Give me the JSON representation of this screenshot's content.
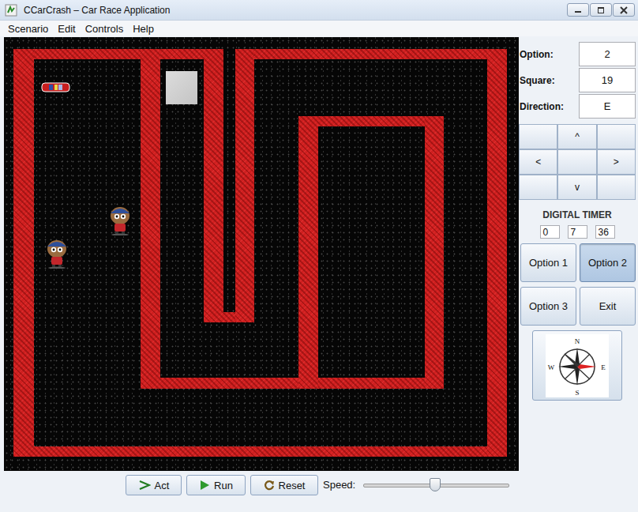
{
  "window": {
    "title": "CCarCrash – Car Race Application"
  },
  "menu": [
    "Scenario",
    "Edit",
    "Controls",
    "Help"
  ],
  "status": [
    {
      "label": "Option:",
      "value": "2"
    },
    {
      "label": "Square:",
      "value": "19"
    },
    {
      "label": "Direction:",
      "value": "E"
    }
  ],
  "arrow_pad": [
    "",
    "^",
    "",
    "<",
    "",
    ">",
    "",
    "v",
    ""
  ],
  "timer": {
    "title": "DIGITAL TIMER",
    "values": [
      "0",
      "7",
      "36"
    ]
  },
  "options": [
    {
      "label": "Option 1",
      "selected": false
    },
    {
      "label": "Option 2",
      "selected": true
    },
    {
      "label": "Option 3",
      "selected": false
    },
    {
      "label": "Exit",
      "selected": false
    }
  ],
  "compass": {
    "labels": [
      "N",
      "E",
      "S",
      "W"
    ]
  },
  "toolbar": {
    "buttons": [
      "Act",
      "Run",
      "Reset"
    ]
  },
  "speed": {
    "label": "Speed:",
    "level": 0.49
  }
}
